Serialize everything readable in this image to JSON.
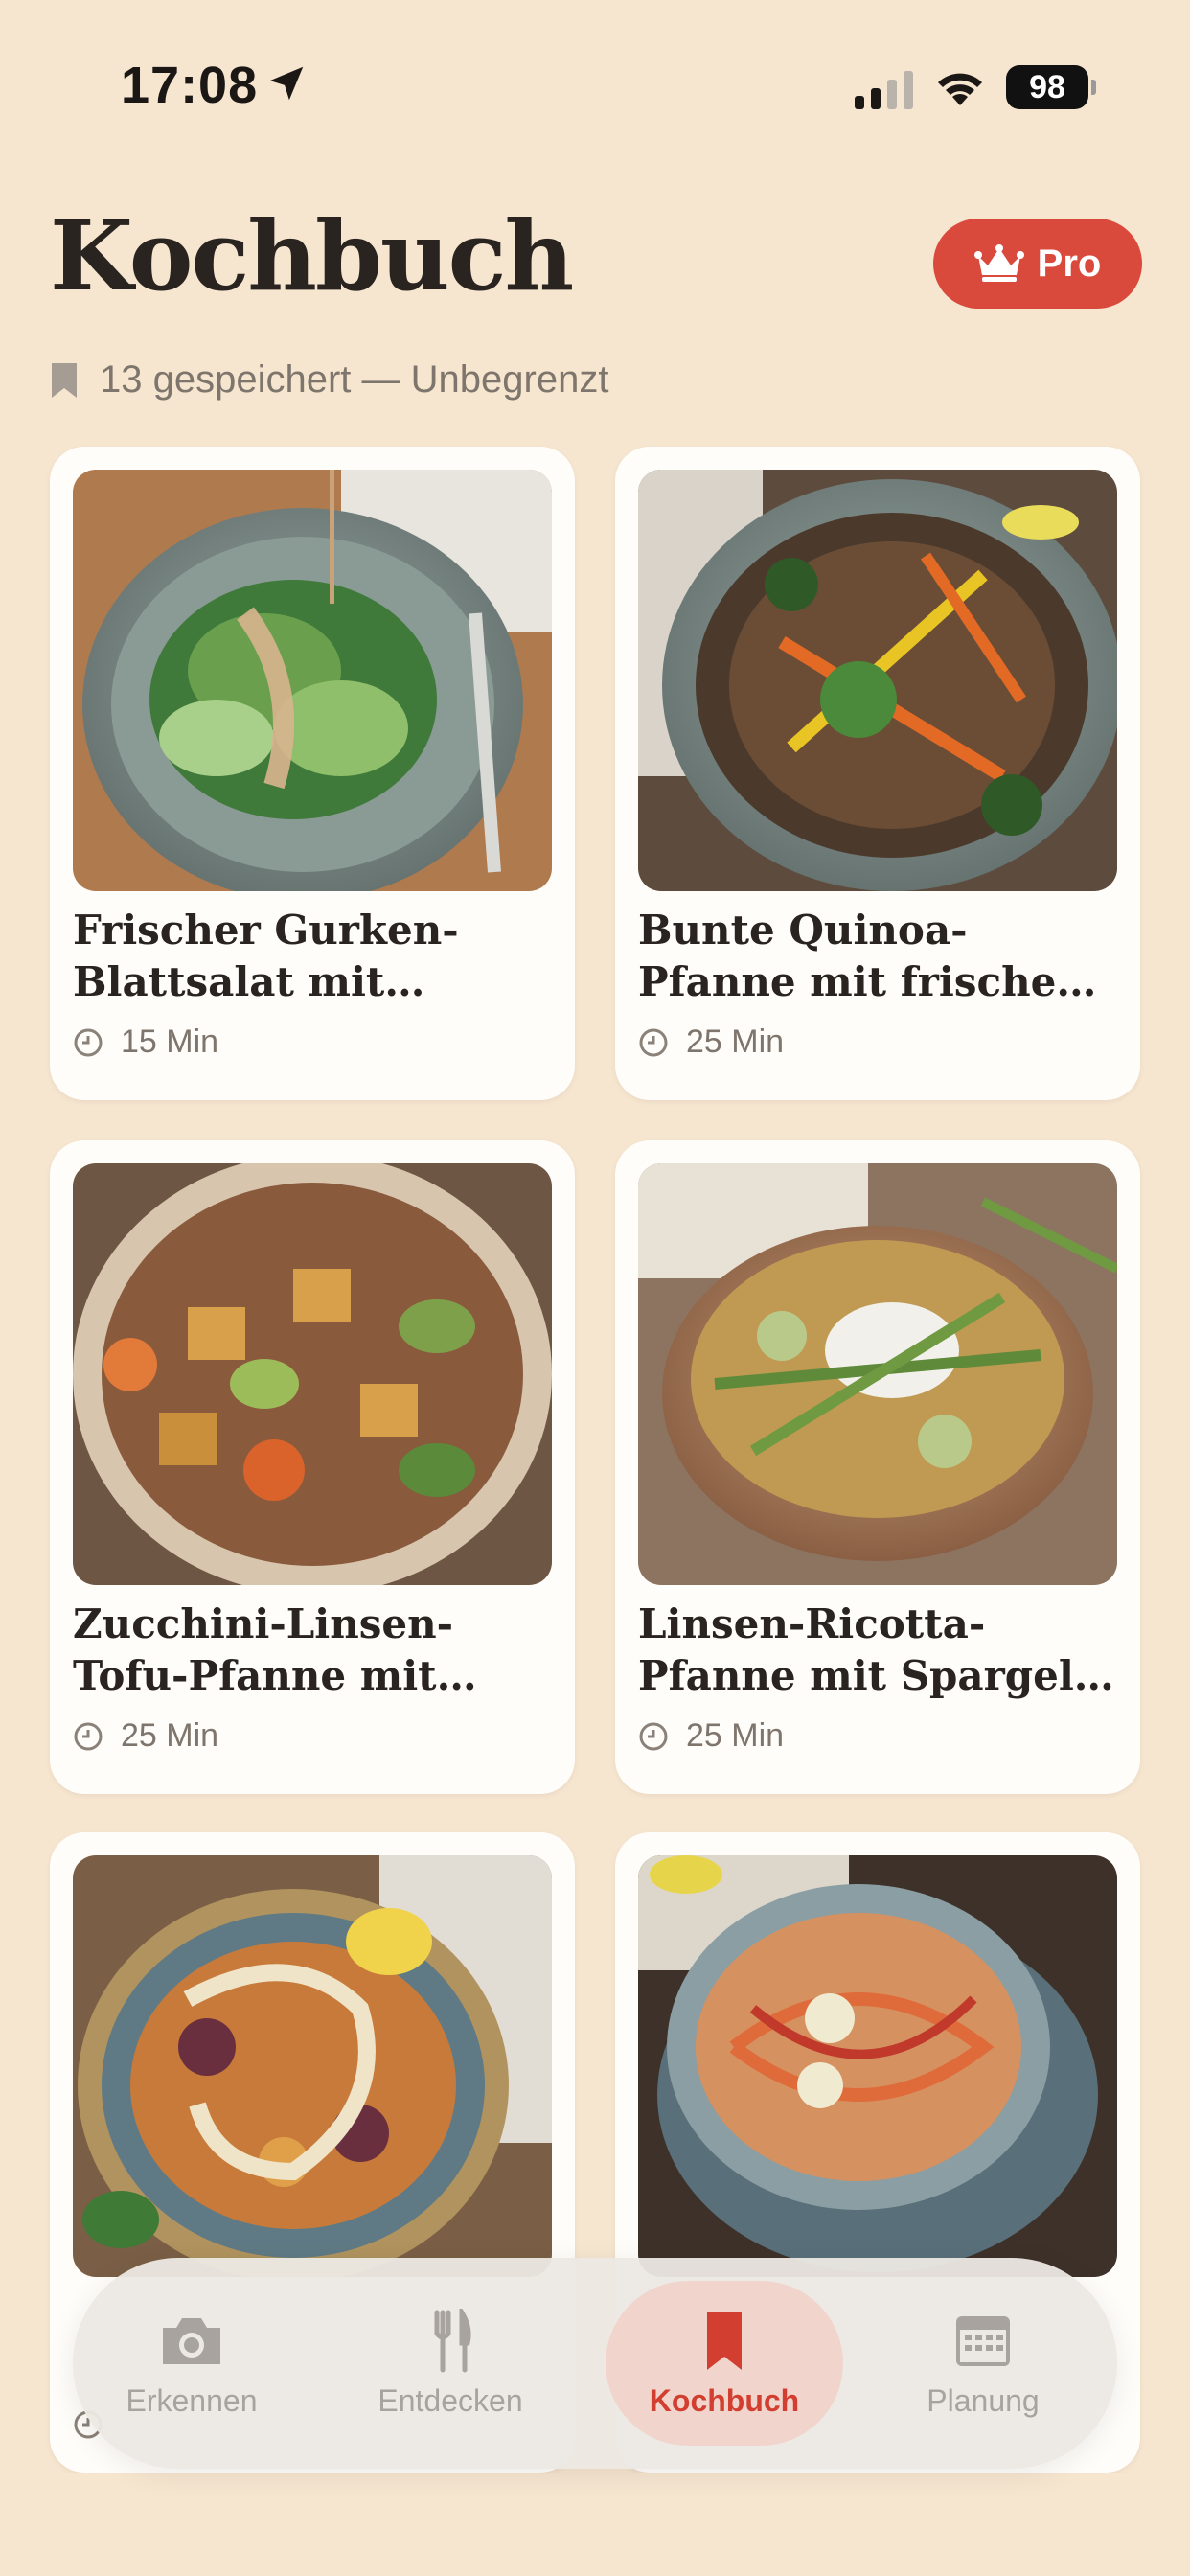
{
  "status_bar": {
    "time": "17:08",
    "battery": "98"
  },
  "header": {
    "title": "Kochbuch",
    "pro_label": "Pro",
    "subtitle": "13 gespeichert — Unbegrenzt"
  },
  "recipes": [
    {
      "title": "Frischer Gurken-Blattsalat mit cremig...",
      "time": "15 Min"
    },
    {
      "title": "Bunte Quinoa-Pfanne mit frischen Kräutern",
      "time": "25 Min"
    },
    {
      "title": "Zucchini-Linsen-Tofu-Pfanne mit frischer P...",
      "time": "25 Min"
    },
    {
      "title": "Linsen-Ricotta-Pfanne mit Spargel und Zucc...",
      "time": "25 Min"
    },
    {
      "title": "",
      "time": ""
    },
    {
      "title": "",
      "time": ""
    }
  ],
  "tabs": [
    {
      "label": "Erkennen",
      "icon": "camera-icon"
    },
    {
      "label": "Entdecken",
      "icon": "fork-knife-icon"
    },
    {
      "label": "Kochbuch",
      "icon": "bookmark-icon",
      "active": true
    },
    {
      "label": "Planung",
      "icon": "calendar-icon"
    }
  ],
  "colors": {
    "background": "#f6e5cf",
    "accent": "#d94a3d",
    "active_tab_bg": "#f1d5cd",
    "card": "#fffdfa"
  }
}
